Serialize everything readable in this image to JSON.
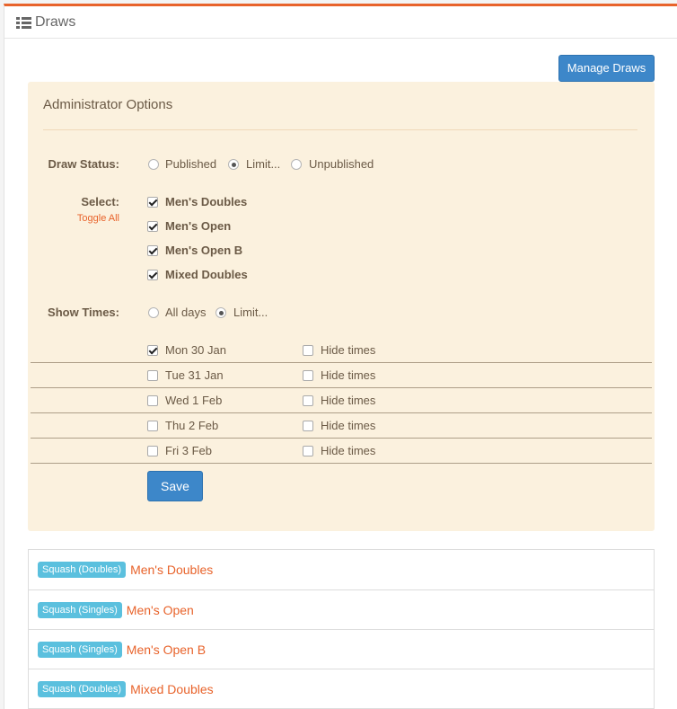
{
  "header": {
    "title": "Draws",
    "icon": "list-icon"
  },
  "toolbar": {
    "manage_label": "Manage Draws"
  },
  "admin": {
    "title": "Administrator Options",
    "draw_status": {
      "label": "Draw Status:",
      "options": [
        {
          "label": "Published",
          "selected": false
        },
        {
          "label": "Limit...",
          "selected": true
        },
        {
          "label": "Unpublished",
          "selected": false
        }
      ]
    },
    "select": {
      "label": "Select:",
      "toggle_label": "Toggle All",
      "items": [
        {
          "label": "Men's Doubles",
          "checked": true
        },
        {
          "label": "Men's Open",
          "checked": true
        },
        {
          "label": "Men's Open B",
          "checked": true
        },
        {
          "label": "Mixed Doubles",
          "checked": true
        }
      ]
    },
    "show_times": {
      "label": "Show Times:",
      "options": [
        {
          "label": "All days",
          "selected": false
        },
        {
          "label": "Limit...",
          "selected": true
        }
      ]
    },
    "days": [
      {
        "label": "Mon 30 Jan",
        "checked": true,
        "hide_label": "Hide times",
        "hide_checked": false
      },
      {
        "label": "Tue 31 Jan",
        "checked": false,
        "hide_label": "Hide times",
        "hide_checked": false
      },
      {
        "label": "Wed 1 Feb",
        "checked": false,
        "hide_label": "Hide times",
        "hide_checked": false
      },
      {
        "label": "Thu 2 Feb",
        "checked": false,
        "hide_label": "Hide times",
        "hide_checked": false
      },
      {
        "label": "Fri 3 Feb",
        "checked": false,
        "hide_label": "Hide times",
        "hide_checked": false
      }
    ],
    "save_label": "Save"
  },
  "draws": [
    {
      "badge": "Squash (Doubles)",
      "name": "Men's Doubles"
    },
    {
      "badge": "Squash (Singles)",
      "name": "Men's Open"
    },
    {
      "badge": "Squash (Singles)",
      "name": "Men's Open B"
    },
    {
      "badge": "Squash (Doubles)",
      "name": "Mixed Doubles"
    }
  ],
  "colors": {
    "accent": "#e8632b",
    "primary": "#3d87c9",
    "badge": "#5bc0de",
    "admin_bg": "#fbf1de"
  }
}
